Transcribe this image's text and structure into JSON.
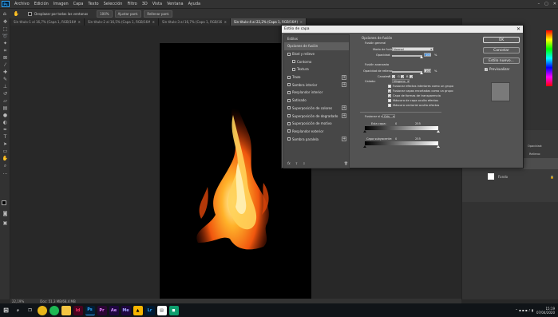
{
  "app": {
    "logo": "Ps"
  },
  "menu": [
    "Archivo",
    "Edición",
    "Imagen",
    "Capa",
    "Texto",
    "Selección",
    "Filtro",
    "3D",
    "Vista",
    "Ventana",
    "Ayuda"
  ],
  "window": {
    "min": "–",
    "max": "▢",
    "close": "✕"
  },
  "options": {
    "scroll_all": "Desplazar por todas las ventanas",
    "zoom": "100%",
    "fit": "Ajustar pant.",
    "fill": "Rellenar pant."
  },
  "tabs": [
    {
      "label": "Sin título-1 al 16,7% (Capa 1, RGB/16#)",
      "active": false
    },
    {
      "label": "Sin título-2 al 16,5% (Capa 1, RGB/16#)",
      "active": false
    },
    {
      "label": "Sin título-3 al 16,7% (Capa 1, RGB/16#)",
      "active": false
    },
    {
      "label": "Sin título-4 al 22,2% (Capa 1, RGB/16#)",
      "active": true
    }
  ],
  "status": {
    "zoom": "22,19%",
    "doc": "Doc: 51,3 MB/68,4 MB"
  },
  "layers": {
    "opacity": "Opacidad:",
    "fill": "Relleno:",
    "background": "Fondo"
  },
  "dialog": {
    "title": "Estilo de capa",
    "left_header": "Estilos",
    "left_items": [
      {
        "label": "Opciones de fusión",
        "checkbox": false,
        "plus": false,
        "indent": false,
        "selected": true
      },
      {
        "label": "Bisel y relieve",
        "checkbox": true,
        "plus": false,
        "indent": false,
        "selected": false
      },
      {
        "label": "Contorno",
        "checkbox": true,
        "plus": false,
        "indent": true,
        "selected": false
      },
      {
        "label": "Textura",
        "checkbox": true,
        "plus": false,
        "indent": true,
        "selected": false
      },
      {
        "label": "Trazo",
        "checkbox": true,
        "plus": true,
        "indent": false,
        "selected": false
      },
      {
        "label": "Sombra interior",
        "checkbox": true,
        "plus": true,
        "indent": false,
        "selected": false
      },
      {
        "label": "Resplandor interior",
        "checkbox": true,
        "plus": false,
        "indent": false,
        "selected": false
      },
      {
        "label": "Satinado",
        "checkbox": true,
        "plus": false,
        "indent": false,
        "selected": false
      },
      {
        "label": "Superposición de colores",
        "checkbox": true,
        "plus": true,
        "indent": false,
        "selected": false
      },
      {
        "label": "Superposición de degradado",
        "checkbox": true,
        "plus": true,
        "indent": false,
        "selected": false
      },
      {
        "label": "Superposición de motivo",
        "checkbox": true,
        "plus": false,
        "indent": false,
        "selected": false
      },
      {
        "label": "Resplandor exterior",
        "checkbox": true,
        "plus": false,
        "indent": false,
        "selected": false
      },
      {
        "label": "Sombra paralela",
        "checkbox": true,
        "plus": true,
        "indent": false,
        "selected": false
      }
    ],
    "footer": {
      "fx": "fx",
      "up": "⇧",
      "down": "⇩",
      "trash": "🗑"
    },
    "middle": {
      "section": "Opciones de fusión",
      "general": "Fusión general",
      "blend_mode_label": "Modo de fusión:",
      "blend_mode_value": "Normal",
      "opacity_label": "Opacidad:",
      "opacity_value": "100",
      "pct": "%",
      "advanced": "Fusión avanzada",
      "fill_opacity_label": "Opacidad de relleno:",
      "fill_opacity_value": "100",
      "channels_label": "Canales:",
      "ch_r": "R",
      "ch_g": "G",
      "ch_b": "B",
      "knockout_label": "Calado:",
      "knockout_value": "Ninguno",
      "checks": [
        {
          "label": "Fusionar efectos interiores como un grupo",
          "checked": false
        },
        {
          "label": "Fusionar capas recortadas como un grupo",
          "checked": true
        },
        {
          "label": "Capa de formas de transparencia",
          "checked": true
        },
        {
          "label": "Máscara de capa oculta efectos",
          "checked": false
        },
        {
          "label": "Máscara vectorial oculta efectos",
          "checked": false
        }
      ],
      "blend_if_label": "Fusionar si es:",
      "blend_if_value": "Gris",
      "this_layer": "Esta capa:",
      "underlying": "Capa subyacente:",
      "v0": "0",
      "v255": "255"
    },
    "buttons": {
      "ok": "OK",
      "cancel": "Cancelar",
      "new_style": "Estilo nuevo...",
      "preview": "Previsualizar"
    }
  },
  "taskbar": {
    "time": "15:19",
    "date": "07/04/2020"
  },
  "colors": {
    "accent": "#31a8ff",
    "dialog_bg": "#535353",
    "panel_bg": "#323232"
  }
}
